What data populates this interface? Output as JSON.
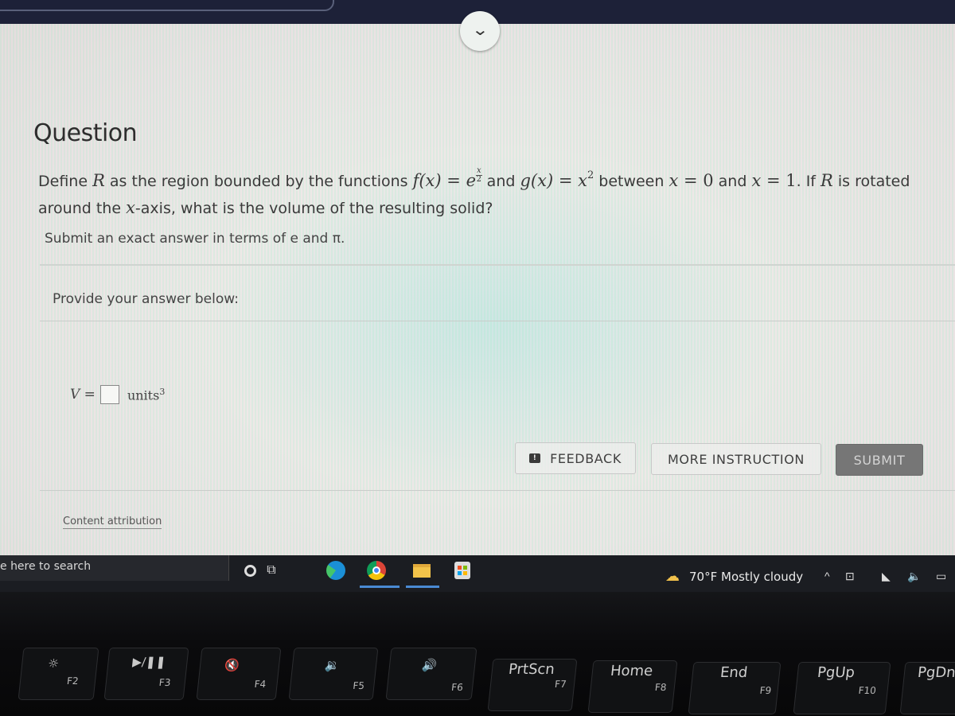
{
  "browser": {
    "collapse_icon": "chevron-down-icon",
    "collapse_glyph": "⌄"
  },
  "question": {
    "title": "Question",
    "text_parts": {
      "p1": "Define ",
      "R": "R",
      "p2": " as the region bounded by the functions ",
      "f_lhs": "f(x)",
      "eq": " = ",
      "e": "e",
      "frac_num": "x",
      "frac_den": "2",
      "p3": " and ",
      "g_lhs": "g(x)",
      "x": "x",
      "sq": "2",
      "p4": " between ",
      "x0": "x",
      "eq0": " = 0",
      "p5": " and ",
      "x1": "x",
      "eq1": " = 1",
      "p6": ". If ",
      "R2": "R",
      "p7": " is rotated around the ",
      "xaxis": "x",
      "p8": "-axis, what is the volume of the resulting solid?"
    },
    "hint": "Submit an exact answer in terms of e and π."
  },
  "answer": {
    "label": "Provide your answer below:",
    "var": "V =",
    "value": "",
    "units": "units",
    "units_exp": "3"
  },
  "buttons": {
    "feedback": "FEEDBACK",
    "feedback_icon": "!",
    "more_instruction": "MORE INSTRUCTION",
    "submit": "SUBMIT"
  },
  "attribution": "Content attribution",
  "taskbar": {
    "search_placeholder": "e here to search",
    "weather": {
      "temp": "70°F",
      "condition": "Mostly cloudy",
      "icon": "☁"
    },
    "tray": {
      "up": "^",
      "meet": "⊡",
      "wifi": "◣",
      "volume": "🔈",
      "battery": "▭"
    }
  },
  "keyboard": {
    "keys": [
      {
        "glyph": "☼",
        "fn": "F2"
      },
      {
        "glyph": "▶/❚❚",
        "fn": "F3"
      },
      {
        "glyph": "🔇",
        "fn": "F4"
      },
      {
        "glyph": "🔉",
        "fn": "F5"
      },
      {
        "glyph": "🔊",
        "fn": "F6"
      },
      {
        "label": "PrtScn",
        "fn": "F7"
      },
      {
        "label": "Home",
        "fn": "F8"
      },
      {
        "label": "End",
        "fn": "F9"
      },
      {
        "label": "PgUp",
        "fn": "F10"
      },
      {
        "label": "PgDn",
        "fn": ""
      }
    ]
  }
}
